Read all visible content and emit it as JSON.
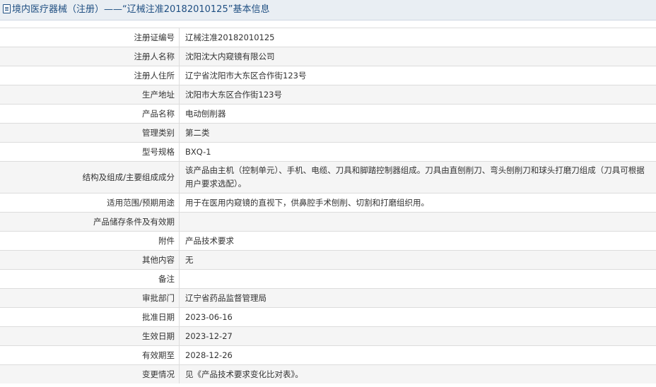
{
  "header": {
    "title": "境内医疗器械（注册）——“辽械注准20182010125”基本信息"
  },
  "rows": [
    {
      "label": "注册证编号",
      "value": "辽械注准20182010125"
    },
    {
      "label": "注册人名称",
      "value": "沈阳沈大内窥镜有限公司"
    },
    {
      "label": "注册人住所",
      "value": "辽宁省沈阳市大东区合作街123号"
    },
    {
      "label": "生产地址",
      "value": "沈阳市大东区合作街123号"
    },
    {
      "label": "产品名称",
      "value": "电动刨削器"
    },
    {
      "label": "管理类别",
      "value": "第二类"
    },
    {
      "label": "型号规格",
      "value": "BXQ-1"
    },
    {
      "label": "结构及组成/主要组成成分",
      "value": "该产品由主机（控制单元）、手机、电缆、刀具和脚踏控制器组成。刀具由直刨削刀、弯头刨削刀和球头打磨刀组成（刀具可根据用户要求选配）。"
    },
    {
      "label": "适用范围/预期用途",
      "value": "用于在医用内窥镜的直视下，供鼻腔手术刨削、切割和打磨组织用。"
    },
    {
      "label": "产品储存条件及有效期",
      "value": ""
    },
    {
      "label": "附件",
      "value": "产品技术要求"
    },
    {
      "label": "其他内容",
      "value": "无"
    },
    {
      "label": "备注",
      "value": ""
    },
    {
      "label": "审批部门",
      "value": "辽宁省药品监督管理局"
    },
    {
      "label": "批准日期",
      "value": "2023-06-16"
    },
    {
      "label": "生效日期",
      "value": "2023-12-27"
    },
    {
      "label": "有效期至",
      "value": "2028-12-26"
    },
    {
      "label": "变更情况",
      "value": "见《产品技术要求变化比对表》。"
    }
  ]
}
